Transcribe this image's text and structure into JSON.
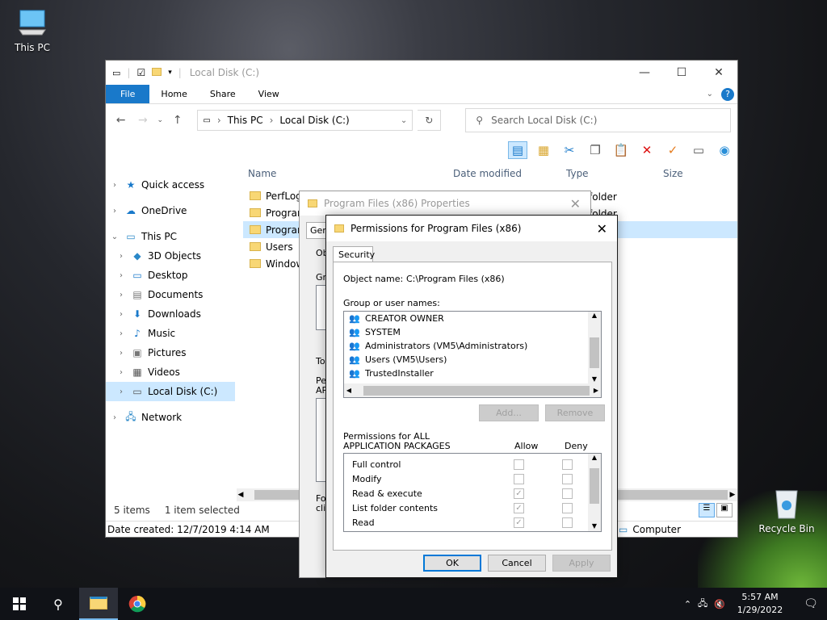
{
  "desktop": {
    "icons": [
      {
        "label": "This PC",
        "icon": "computer-icon"
      },
      {
        "label": "Recycle Bin",
        "icon": "recycle-bin-icon"
      }
    ]
  },
  "explorer": {
    "title": "Local Disk (C:)",
    "ribbon_tabs": [
      "File",
      "Home",
      "Share",
      "View"
    ],
    "address": [
      "This PC",
      "Local Disk (C:)"
    ],
    "search_placeholder": "Search Local Disk (C:)",
    "nav": {
      "quick_access": "Quick access",
      "onedrive": "OneDrive",
      "this_pc": "This PC",
      "children": [
        "3D Objects",
        "Desktop",
        "Documents",
        "Downloads",
        "Music",
        "Pictures",
        "Videos",
        "Local Disk (C:)"
      ],
      "network": "Network"
    },
    "columns": {
      "name": "Name",
      "date": "Date modified",
      "type": "Type",
      "size": "Size"
    },
    "files": [
      "PerfLog",
      "Program",
      "Program",
      "Users",
      "Window"
    ],
    "file_types": [
      "folder",
      "folder"
    ],
    "status": {
      "count": "5 items",
      "selected": "1 item selected"
    },
    "details": {
      "date_created": "Date created: 12/7/2019 4:14 AM",
      "location": "Computer"
    }
  },
  "properties": {
    "title": "Program Files (x86) Properties",
    "fragments": {
      "tab": "Gen",
      "ob": "Ob",
      "gr": "Gr",
      "to": "To",
      "pe": "Pe",
      "ap": "AP",
      "fo": "For",
      "cli": "clic"
    }
  },
  "permissions": {
    "title": "Permissions for Program Files (x86)",
    "tab": "Security",
    "object_label": "Object name:",
    "object_value": "C:\\Program Files (x86)",
    "groups_label": "Group or user names:",
    "groups": [
      "CREATOR OWNER",
      "SYSTEM",
      "Administrators (VM5\\Administrators)",
      "Users (VM5\\Users)",
      "TrustedInstaller"
    ],
    "add": "Add...",
    "remove": "Remove",
    "perm_label_1": "Permissions for ALL",
    "perm_label_2": "APPLICATION PACKAGES",
    "allow": "Allow",
    "deny": "Deny",
    "permissions": [
      {
        "name": "Full control",
        "allow": false,
        "deny": false
      },
      {
        "name": "Modify",
        "allow": false,
        "deny": false
      },
      {
        "name": "Read & execute",
        "allow": true,
        "deny": false
      },
      {
        "name": "List folder contents",
        "allow": true,
        "deny": false
      },
      {
        "name": "Read",
        "allow": true,
        "deny": false
      }
    ],
    "ok": "OK",
    "cancel": "Cancel",
    "apply": "Apply"
  },
  "taskbar": {
    "time": "5:57 AM",
    "date": "1/29/2022"
  },
  "colors": {
    "accent": "#1979ca",
    "selection": "#cce8ff",
    "taskbar": "#101217"
  }
}
